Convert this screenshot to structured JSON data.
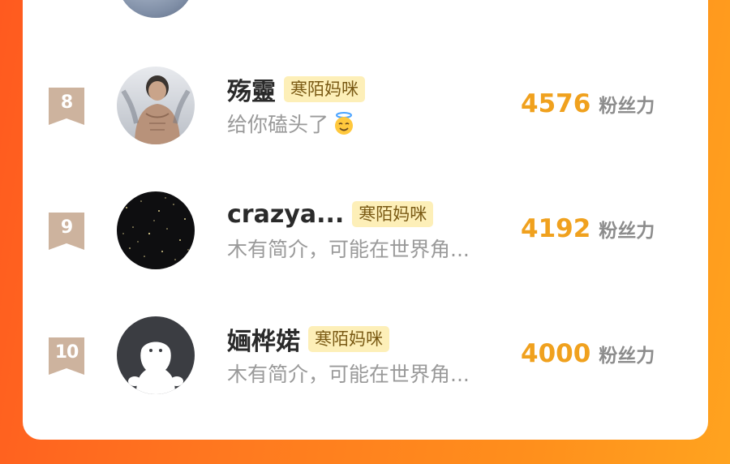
{
  "list": {
    "rows": [
      {
        "rank": "8",
        "name": "殇靈",
        "tag": "寒陌妈咪",
        "bio": "给你磕头了",
        "bio_emoji": "smiling-face-with-halo-icon",
        "score": "4576",
        "unit": "粉丝力"
      },
      {
        "rank": "9",
        "name": "crazya...",
        "tag": "寒陌妈咪",
        "bio": "木有简介，可能在世界角...",
        "score": "4192",
        "unit": "粉丝力"
      },
      {
        "rank": "10",
        "name": "婳桦婼",
        "tag": "寒陌妈咪",
        "bio": "木有简介，可能在世界角...",
        "score": "4000",
        "unit": "粉丝力"
      }
    ]
  },
  "colors": {
    "score": "#f0a11e",
    "tag_bg": "#fdefb8",
    "badge": "#cdb39e",
    "background_start": "#ff5a1f",
    "background_end": "#ffa31f"
  }
}
